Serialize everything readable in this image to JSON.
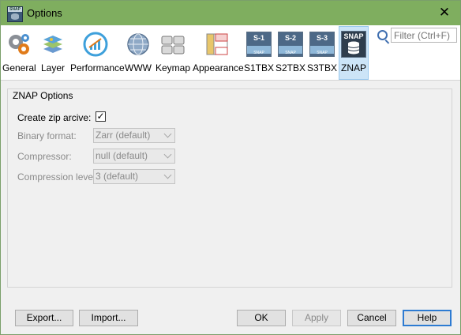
{
  "window": {
    "title": "Options",
    "app_icon_text": "SNAP"
  },
  "toolbar": {
    "categories": [
      {
        "label": "General"
      },
      {
        "label": "Layer"
      },
      {
        "label": "Performance"
      },
      {
        "label": "WWW"
      },
      {
        "label": "Keymap"
      },
      {
        "label": "Appearance"
      },
      {
        "label": "S1TBX",
        "badge": "S-1",
        "sub": "SNAP"
      },
      {
        "label": "S2TBX",
        "badge": "S-2",
        "sub": "SNAP"
      },
      {
        "label": "S3TBX",
        "badge": "S-3",
        "sub": "SNAP"
      },
      {
        "label": "ZNAP",
        "badge": "SNAP",
        "selected": true
      }
    ]
  },
  "search": {
    "placeholder": "Filter (Ctrl+F)"
  },
  "panel": {
    "title": "ZNAP Options",
    "create_zip": {
      "label": "Create zip arcive:",
      "checked": true,
      "mark": "✓"
    },
    "binary_format": {
      "label": "Binary format:",
      "value": "Zarr (default)"
    },
    "compressor": {
      "label": "Compressor:",
      "value": "null (default)"
    },
    "compression_level": {
      "label": "Compression level:",
      "value": "3 (default)"
    }
  },
  "buttons": {
    "export": "Export...",
    "import": "Import...",
    "ok": "OK",
    "apply": "Apply",
    "cancel": "Cancel",
    "help": "Help"
  }
}
